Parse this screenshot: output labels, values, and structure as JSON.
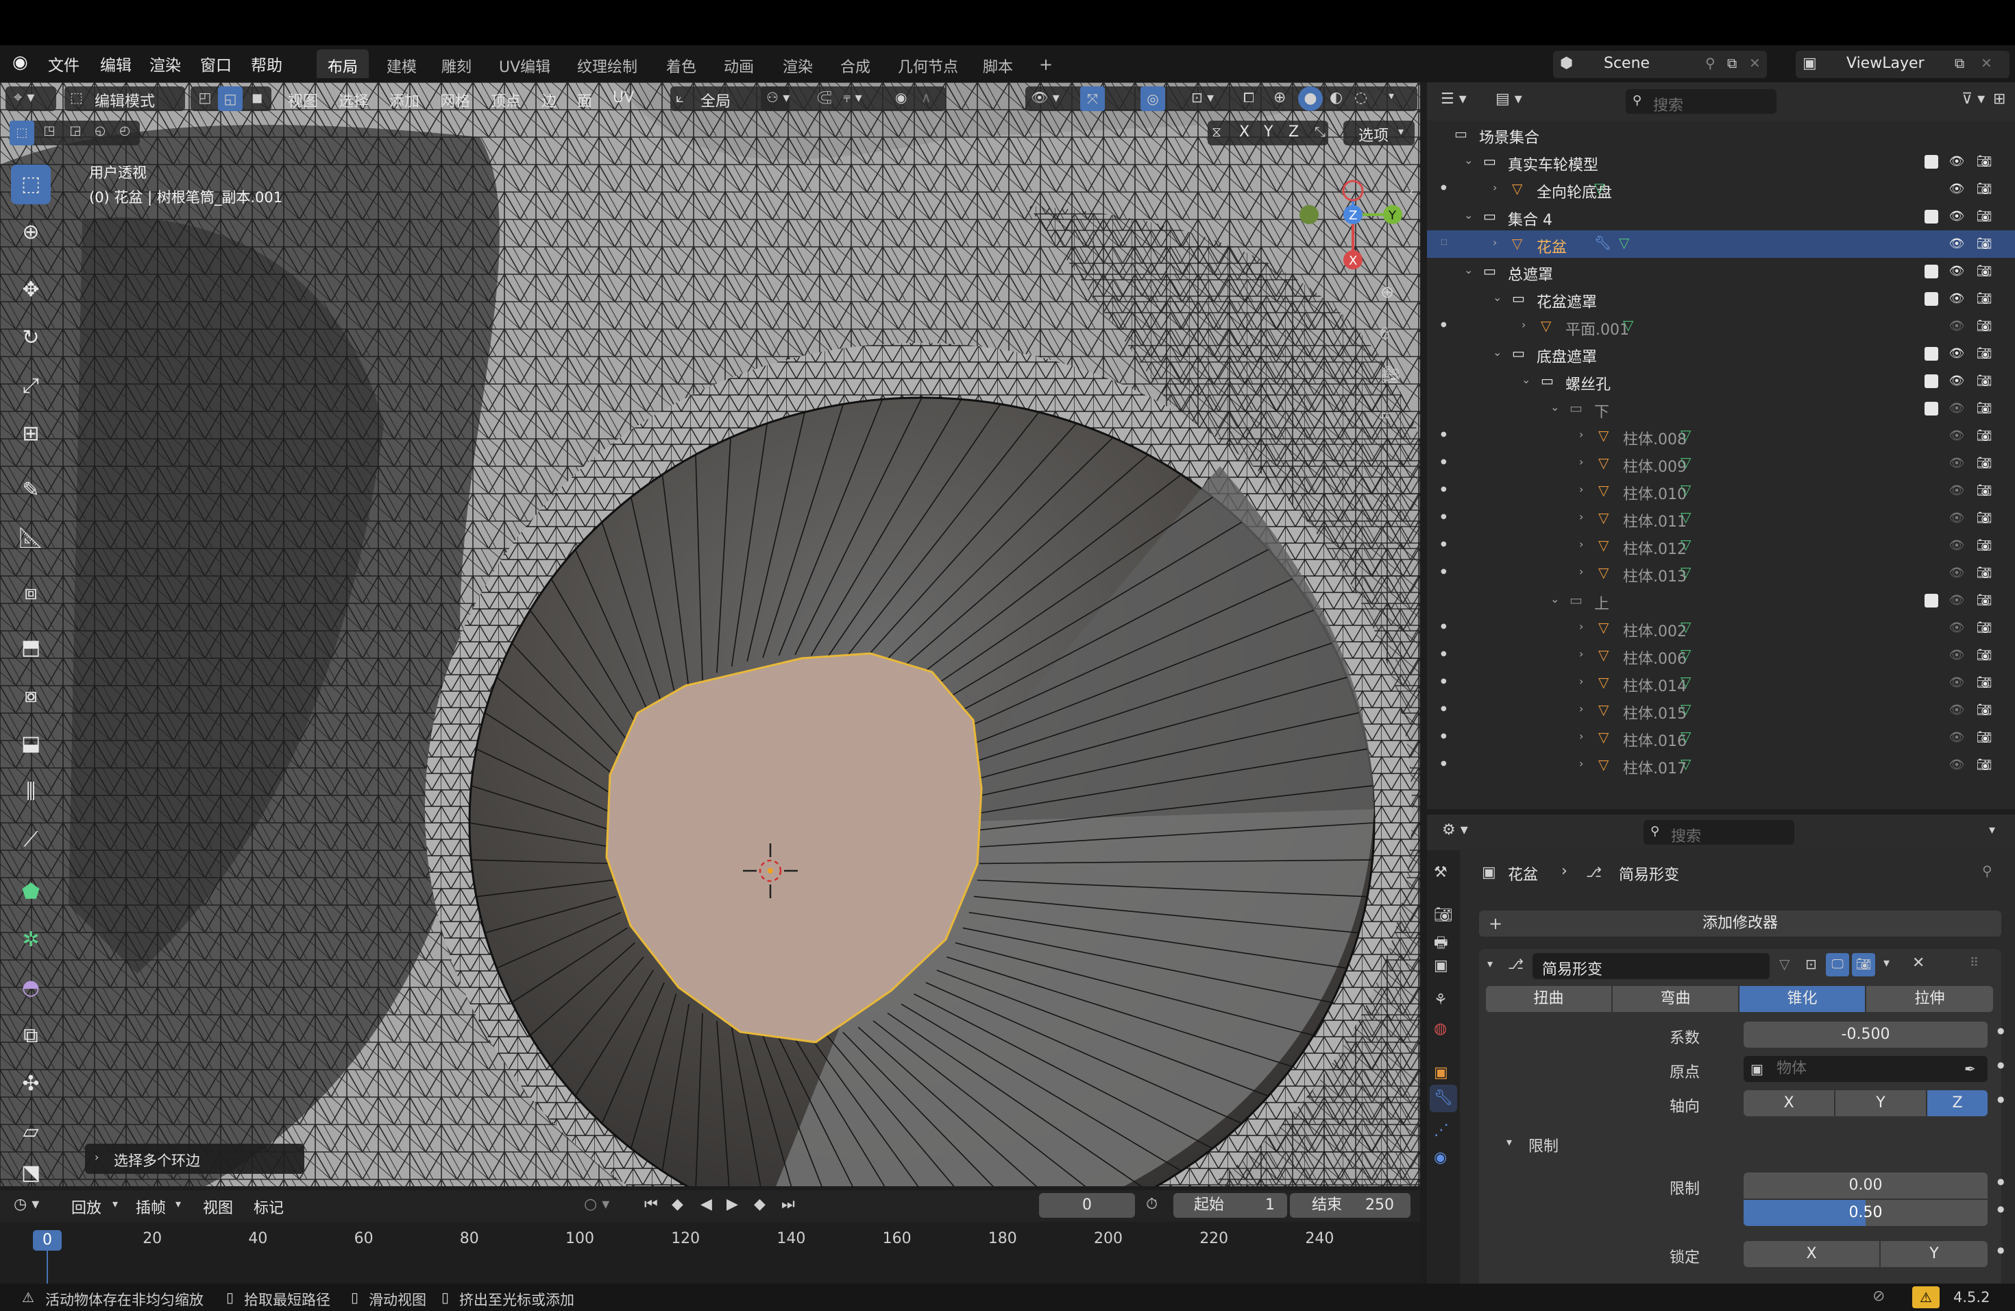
{
  "menubar": {
    "items": [
      "文件",
      "编辑",
      "渲染",
      "窗口",
      "帮助"
    ],
    "workspace_tabs": [
      "布局",
      "建模",
      "雕刻",
      "UV编辑",
      "纹理绘制",
      "着色",
      "动画",
      "渲染",
      "合成",
      "几何节点",
      "脚本"
    ],
    "active_tab": "布局",
    "add_tab": "+",
    "scene": "Scene",
    "view_layer": "ViewLayer"
  },
  "viewport": {
    "mode": "编辑模式",
    "menus": [
      "视图",
      "选择",
      "添加",
      "网格",
      "顶点",
      "边",
      "面",
      "UV"
    ],
    "transform_orientation": "全局",
    "axis_toggles": [
      "X",
      "Y",
      "Z"
    ],
    "options_label": "选项",
    "overlay_title": "用户透视",
    "overlay_object": "(0) 花盆 | 树根笔筒_副本.001",
    "gizmo_axes": {
      "x": "X",
      "y": "Y",
      "z": "Z"
    },
    "last_op_panel": "选择多个环边"
  },
  "outliner": {
    "search_placeholder": "搜索",
    "rows": [
      {
        "label": "场景集合",
        "level": 0,
        "type": "scene"
      },
      {
        "label": "真实车轮模型",
        "level": 1,
        "type": "collection",
        "checked": true
      },
      {
        "label": "全向轮底盘",
        "level": 2,
        "type": "object"
      },
      {
        "label": "集合 4",
        "level": 1,
        "type": "collection",
        "checked": true
      },
      {
        "label": "花盆",
        "level": 2,
        "type": "object",
        "selected": true
      },
      {
        "label": "总遮罩",
        "level": 1,
        "type": "collection",
        "checked": true
      },
      {
        "label": "花盆遮罩",
        "level": 2,
        "type": "collection",
        "checked": true
      },
      {
        "label": "平面.001",
        "level": 3,
        "type": "object",
        "dim": true
      },
      {
        "label": "底盘遮罩",
        "level": 2,
        "type": "collection",
        "checked": true
      },
      {
        "label": "螺丝孔",
        "level": 3,
        "type": "collection",
        "checked": true
      },
      {
        "label": "下",
        "level": 4,
        "type": "collection",
        "checked": true,
        "dim": true
      },
      {
        "label": "柱体.008",
        "level": 5,
        "type": "object",
        "dim": true
      },
      {
        "label": "柱体.009",
        "level": 5,
        "type": "object",
        "dim": true
      },
      {
        "label": "柱体.010",
        "level": 5,
        "type": "object",
        "dim": true
      },
      {
        "label": "柱体.011",
        "level": 5,
        "type": "object",
        "dim": true
      },
      {
        "label": "柱体.012",
        "level": 5,
        "type": "object",
        "dim": true
      },
      {
        "label": "柱体.013",
        "level": 5,
        "type": "object",
        "dim": true
      },
      {
        "label": "上",
        "level": 4,
        "type": "collection",
        "checked": true,
        "dim": true
      },
      {
        "label": "柱体.002",
        "level": 5,
        "type": "object",
        "dim": true
      },
      {
        "label": "柱体.006",
        "level": 5,
        "type": "object",
        "dim": true
      },
      {
        "label": "柱体.014",
        "level": 5,
        "type": "object",
        "dim": true
      },
      {
        "label": "柱体.015",
        "level": 5,
        "type": "object",
        "dim": true
      },
      {
        "label": "柱体.016",
        "level": 5,
        "type": "object",
        "dim": true
      },
      {
        "label": "柱体.017",
        "level": 5,
        "type": "object",
        "dim": true
      }
    ]
  },
  "properties": {
    "search_placeholder": "搜索",
    "breadcrumb_object": "花盆",
    "breadcrumb_modifier": "简易形变",
    "add_modifier": "添加修改器",
    "modifier_name": "简易形变",
    "deform_modes": [
      "扭曲",
      "弯曲",
      "锥化",
      "拉伸"
    ],
    "active_mode": "锥化",
    "factor_label": "系数",
    "factor_value": "-0.500",
    "origin_label": "原点",
    "origin_placeholder": "物体",
    "axis_label": "轴向",
    "axes": [
      "X",
      "Y",
      "Z"
    ],
    "active_axis": "Z",
    "limits_header": "限制",
    "limits_label": "限制",
    "limit_min": "0.00",
    "limit_max": "0.50",
    "lock_label": "锁定",
    "lock_axes": [
      "X",
      "Y"
    ]
  },
  "timeline": {
    "menus": [
      "回放",
      "插帧",
      "视图",
      "标记"
    ],
    "current_frame": "0",
    "start_label": "起始",
    "start_value": "1",
    "end_label": "结束",
    "end_value": "250",
    "ruler": [
      "0",
      "20",
      "40",
      "60",
      "80",
      "100",
      "120",
      "140",
      "160",
      "180",
      "200",
      "220",
      "240"
    ]
  },
  "statusbar": {
    "warning": "活动物体存在非均匀缩放",
    "hints": [
      "拾取最短路径",
      "滑动视图",
      "挤出至光标或添加"
    ],
    "version": "4.5.2"
  },
  "colors": {
    "accent": "#4772b3",
    "selection": "#334d80",
    "face_select": "#b7a093",
    "object_icon": "#e5963c",
    "mesh_icon": "#4fc07a"
  }
}
